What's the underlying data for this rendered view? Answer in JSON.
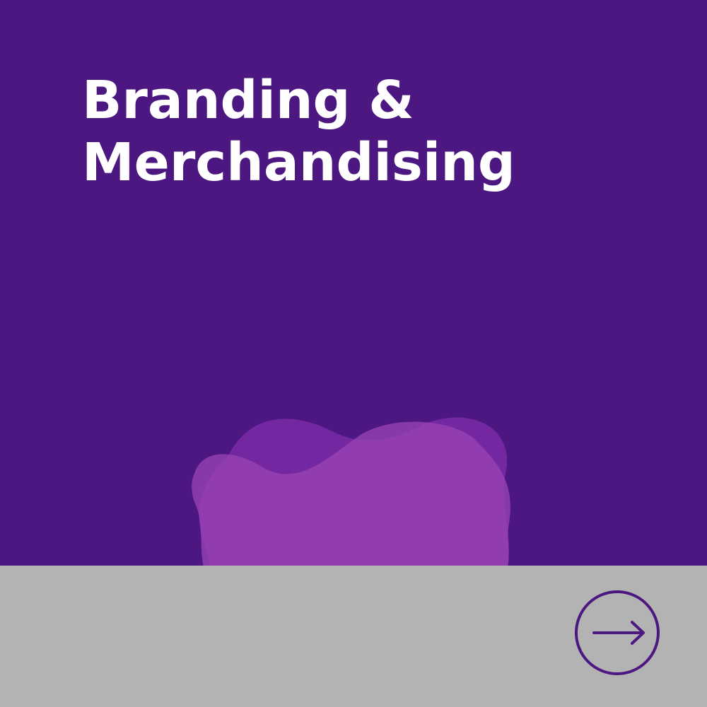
{
  "card": {
    "title_line_1": "Branding &",
    "title_line_2": "Merchandising",
    "next_button_icon": "arrow-right-icon",
    "decoration_icon": "blob-shape",
    "colors": {
      "background": "#4c1780",
      "title": "#ffffff",
      "footer": "#b3b3b3",
      "accent": "#4c1780",
      "blob_back": "#7a2aa6",
      "blob_front": "#9b46b6"
    }
  }
}
